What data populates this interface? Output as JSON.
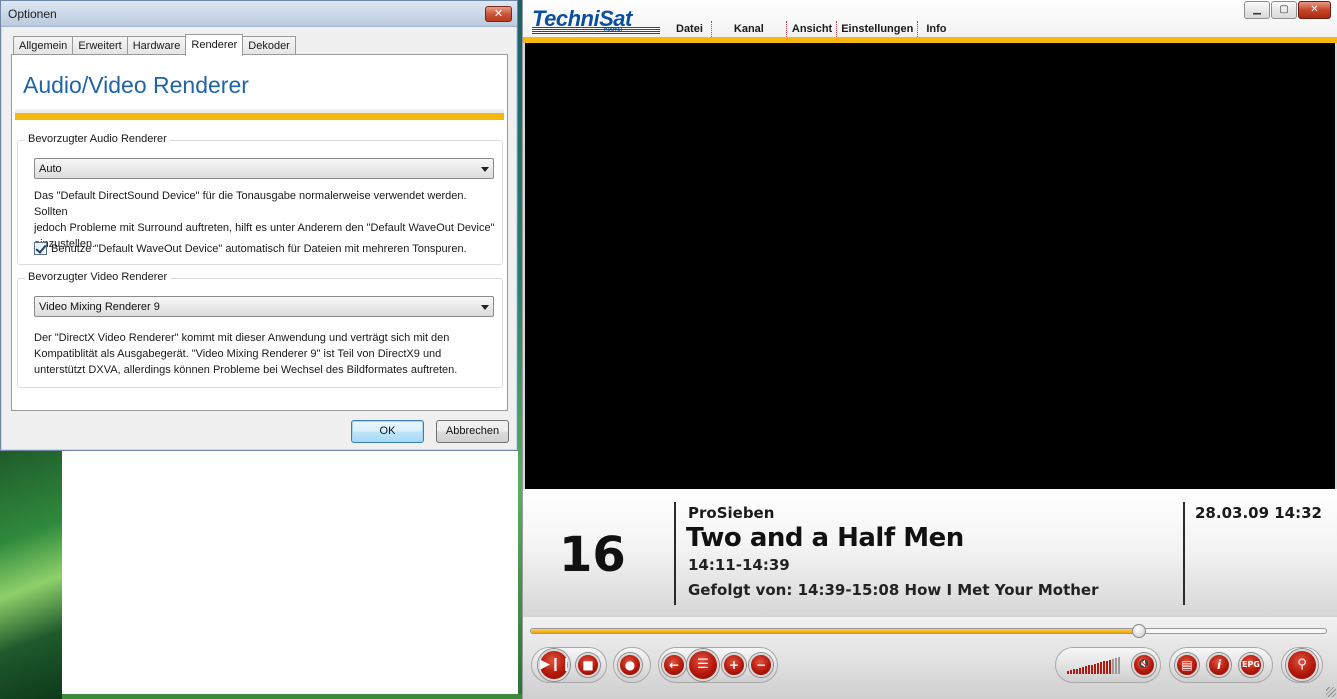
{
  "dialog": {
    "title": "Optionen",
    "close_glyph": "✕",
    "tabs": [
      {
        "label": "Allgemein",
        "active": false
      },
      {
        "label": "Erweitert",
        "active": false
      },
      {
        "label": "Hardware",
        "active": false
      },
      {
        "label": "Renderer",
        "active": true
      },
      {
        "label": "Dekoder",
        "active": false
      }
    ],
    "heading": "Audio/Video Renderer",
    "audio_group": {
      "legend": "Bevorzugter Audio Renderer",
      "selected": "Auto",
      "desc_lines": [
        "Das \"Default DirectSound Device\" für die Tonausgabe normalerweise verwendet werden. Sollten",
        "jedoch Probleme mit Surround auftreten, hilft es unter Anderem den \"Default WaveOut Device\"",
        "einzustellen."
      ],
      "checkbox_label": "Benutze \"Default WaveOut Device\" automatisch für Dateien mit mehreren Tonspuren.",
      "checkbox_checked": true
    },
    "video_group": {
      "legend": "Bevorzugter Video Renderer",
      "selected": "Video Mixing Renderer 9",
      "desc_lines": [
        "Der \"DirectX Video Renderer\" kommt mit dieser Anwendung und verträgt sich mit den",
        "Kompatiblität als Ausgabegerät. \"Video Mixing Renderer 9\" ist Teil von DirectX9 und",
        "unterstützt DXVA, allerdings können Probleme bei Wechsel des Bildformates auftreten."
      ]
    },
    "ok_label": "OK",
    "cancel_label": "Abbrechen"
  },
  "player": {
    "logo": "TechniSat",
    "logo_sub": "DIGITAL",
    "menu": [
      "Datei",
      "Kanal",
      "Ansicht",
      "Einstellungen",
      "Info"
    ],
    "window_buttons": {
      "minimize": "▁",
      "maximize": "▢",
      "close": "✕"
    },
    "channel_number": "16",
    "channel_name": "ProSieben",
    "program_title": "Two and a Half Men",
    "program_time": "14:11-14:39",
    "next_program": "Gefolgt von: 14:39-15:08 How I Met Your Mother",
    "datetime": "28.03.09 14:32",
    "progress_fraction": 0.765,
    "volume_fraction": 0.8,
    "accent_color": "#f5b80c",
    "brand_color": "#0a4fa0",
    "control_color": "#b5180b",
    "controls": {
      "play_pause": "▶❙❙",
      "stop": "■",
      "record": "●",
      "back": "←",
      "list": "☰",
      "plus": "+",
      "minus": "−",
      "mute": "🔇",
      "teletext": "▤",
      "info": "i",
      "epg": "EPG",
      "search": "⚲"
    }
  }
}
